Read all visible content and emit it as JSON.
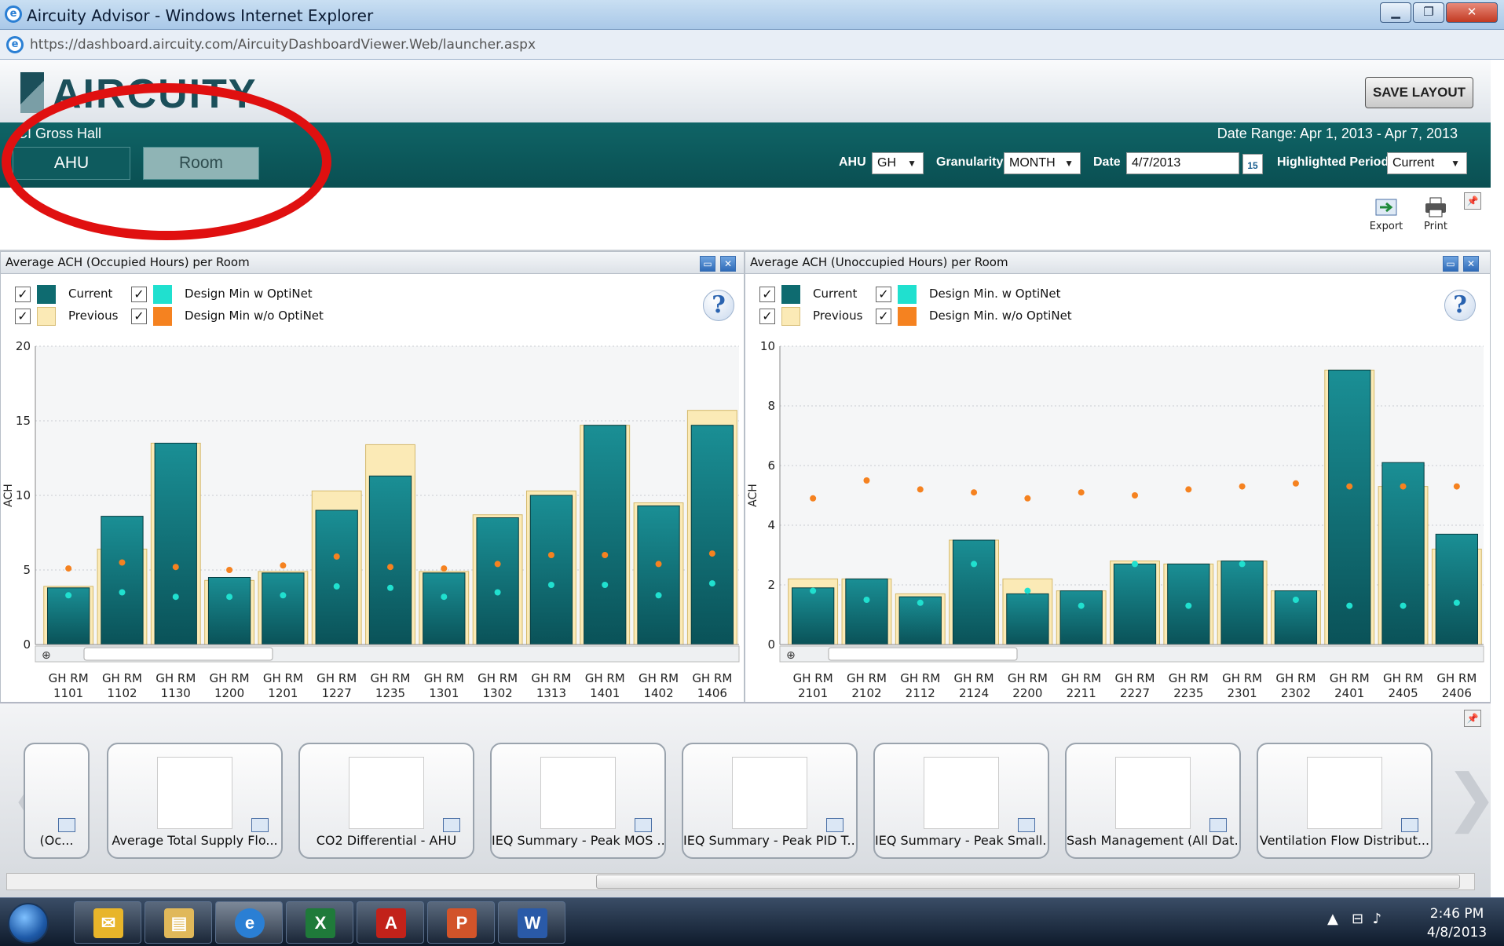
{
  "window": {
    "title": "Aircuity Advisor - Windows Internet Explorer",
    "url": "https://dashboard.aircuity.com/AircuityDashboardViewer.Web/launcher.aspx",
    "min_label": "▁",
    "max_label": "❐",
    "close_label": "✕"
  },
  "header": {
    "logo_text": "AIRCUITY",
    "save_layout": "SAVE LAYOUT",
    "building": "CI Gross Hall",
    "date_range": "Date Range: Apr 1, 2013 - Apr 7, 2013",
    "tabs": [
      {
        "label": "AHU"
      },
      {
        "label": "Room"
      }
    ],
    "controls": {
      "ahu_label": "AHU",
      "ahu_value": "GH",
      "granularity_label": "Granularity",
      "granularity_value": "MONTH",
      "date_label": "Date",
      "date_value": "4/7/2013",
      "calendar_day": "15",
      "period_label": "Highlighted Period",
      "period_value": "Current"
    }
  },
  "toolbar": {
    "export": "Export",
    "print": "Print"
  },
  "colors": {
    "current": "#0e6b70",
    "previous": "#fbeab6",
    "design_w": "#20e0cf",
    "design_wo": "#f58220",
    "teal_header": "#0f6466",
    "annotation": "#e01010"
  },
  "panels": [
    {
      "title": "Average ACH (Occupied Hours) per Room",
      "legend": {
        "current": "Current",
        "previous": "Previous",
        "design_w": "Design Min w OptiNet",
        "design_wo": "Design Min w/o OptiNet"
      },
      "help": "?"
    },
    {
      "title": "Average ACH (Unoccupied Hours) per Room",
      "legend": {
        "current": "Current",
        "previous": "Previous",
        "design_w": "Design Min. w OptiNet",
        "design_wo": "Design Min. w/o OptiNet"
      },
      "help": "?"
    }
  ],
  "chart_data": [
    {
      "type": "bar",
      "title": "Average ACH (Occupied Hours) per Room",
      "ylabel": "ACH",
      "ylim": [
        0,
        20
      ],
      "yticks": [
        0,
        5,
        10,
        15,
        20
      ],
      "categories": [
        "GH RM 1101",
        "GH RM 1102",
        "GH RM 1130",
        "GH RM 1200",
        "GH RM 1201",
        "GH RM 1227",
        "GH RM 1235",
        "GH RM 1301",
        "GH RM 1302",
        "GH RM 1313",
        "GH RM 1401",
        "GH RM 1402",
        "GH RM 1406"
      ],
      "series": [
        {
          "name": "Current",
          "kind": "bar",
          "values": [
            3.8,
            8.6,
            13.5,
            4.5,
            4.8,
            9.0,
            11.3,
            4.8,
            8.5,
            10.0,
            14.7,
            9.3,
            14.7
          ]
        },
        {
          "name": "Previous",
          "kind": "bar",
          "values": [
            3.9,
            6.4,
            13.5,
            4.3,
            4.9,
            10.3,
            13.4,
            4.9,
            8.7,
            10.3,
            14.7,
            9.5,
            15.7
          ]
        },
        {
          "name": "Design Min w OptiNet",
          "kind": "point",
          "values": [
            3.3,
            3.5,
            3.2,
            3.2,
            3.3,
            3.9,
            3.8,
            3.2,
            3.5,
            4.0,
            4.0,
            3.3,
            4.1
          ]
        },
        {
          "name": "Design Min w/o OptiNet",
          "kind": "point",
          "values": [
            5.1,
            5.5,
            5.2,
            5.0,
            5.3,
            5.9,
            5.2,
            5.1,
            5.4,
            6.0,
            6.0,
            5.4,
            6.1
          ]
        }
      ]
    },
    {
      "type": "bar",
      "title": "Average ACH (Unoccupied Hours) per Room",
      "ylabel": "ACH",
      "ylim": [
        0,
        10
      ],
      "yticks": [
        0,
        2,
        4,
        6,
        8,
        10
      ],
      "categories": [
        "GH RM 2101",
        "GH RM 2102",
        "GH RM 2112",
        "GH RM 2124",
        "GH RM 2200",
        "GH RM 2211",
        "GH RM 2227",
        "GH RM 2235",
        "GH RM 2301",
        "GH RM 2302",
        "GH RM 2401",
        "GH RM 2405",
        "GH RM 2406"
      ],
      "series": [
        {
          "name": "Current",
          "kind": "bar",
          "values": [
            1.9,
            2.2,
            1.6,
            3.5,
            1.7,
            1.8,
            2.7,
            2.7,
            2.8,
            1.8,
            9.2,
            6.1,
            3.7
          ]
        },
        {
          "name": "Previous",
          "kind": "bar",
          "values": [
            2.2,
            2.2,
            1.7,
            3.5,
            2.2,
            1.8,
            2.8,
            2.7,
            2.8,
            1.8,
            9.2,
            5.3,
            3.2
          ]
        },
        {
          "name": "Design Min. w OptiNet",
          "kind": "point",
          "values": [
            1.8,
            1.5,
            1.4,
            2.7,
            1.8,
            1.3,
            2.7,
            1.3,
            2.7,
            1.5,
            1.3,
            1.3,
            1.4
          ]
        },
        {
          "name": "Design Min. w/o OptiNet",
          "kind": "point",
          "values": [
            4.9,
            5.5,
            5.2,
            5.1,
            4.9,
            5.1,
            5.0,
            5.2,
            5.3,
            5.4,
            5.3,
            5.3,
            5.3
          ]
        }
      ]
    }
  ],
  "strip": {
    "thumbnails": [
      {
        "label": "(Oc..."
      },
      {
        "label": "Average Total Supply Flo..."
      },
      {
        "label": "CO2 Differential - AHU"
      },
      {
        "label": "IEQ Summary - Peak MOS ..."
      },
      {
        "label": "IEQ Summary - Peak PID T..."
      },
      {
        "label": "IEQ Summary - Peak Small..."
      },
      {
        "label": "Sash Management (All Dat..."
      },
      {
        "label": "Ventilation Flow Distribut..."
      }
    ]
  },
  "taskbar": {
    "time": "2:46 PM",
    "date": "4/8/2013"
  }
}
